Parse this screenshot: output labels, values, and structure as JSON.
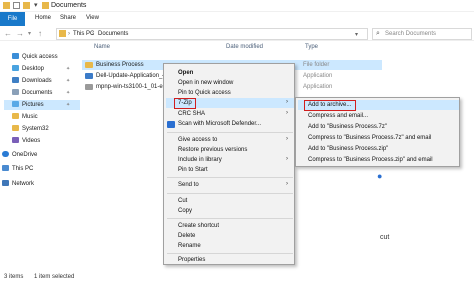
{
  "window": {
    "title": "Documents"
  },
  "ribbon": {
    "tabs": [
      "File",
      "Home",
      "Share",
      "View"
    ]
  },
  "address": {
    "path": [
      "This PC",
      "Documents"
    ],
    "search_placeholder": "Search Documents"
  },
  "nav": {
    "items": [
      {
        "label": "Quick access",
        "icon": "star-icon"
      },
      {
        "label": "Desktop",
        "icon": "desktop-icon"
      },
      {
        "label": "Downloads",
        "icon": "download-icon"
      },
      {
        "label": "Documents",
        "icon": "documents-icon"
      },
      {
        "label": "Pictures",
        "icon": "pictures-icon"
      },
      {
        "label": "Music",
        "icon": "music-icon"
      },
      {
        "label": "System32",
        "icon": "folder-icon"
      },
      {
        "label": "Videos",
        "icon": "videos-icon"
      },
      {
        "label": "OneDrive",
        "icon": "cloud-icon"
      },
      {
        "label": "This PC",
        "icon": "pc-icon"
      },
      {
        "label": "Network",
        "icon": "network-icon"
      }
    ]
  },
  "filelist": {
    "columns": {
      "name": "Name",
      "date": "Date modified",
      "type": "Type"
    },
    "rows": [
      {
        "name": "Business Process",
        "date": "",
        "type": "File folder"
      },
      {
        "name": "Dell-Update-Application_4",
        "date": "",
        "type": "Application"
      },
      {
        "name": "mpnp-win-ts3100-1_01-ea",
        "date": "",
        "type": "Application"
      }
    ]
  },
  "context_menu": {
    "items": [
      {
        "label": "Open"
      },
      {
        "label": "Open in new window"
      },
      {
        "label": "Pin to Quick access"
      },
      {
        "label": "7-Zip"
      },
      {
        "label": "CRC SHA"
      },
      {
        "label": "Scan with Microsoft Defender..."
      },
      {
        "label": "Give access to"
      },
      {
        "label": "Restore previous versions"
      },
      {
        "label": "Include in library"
      },
      {
        "label": "Pin to Start"
      },
      {
        "label": "Send to"
      },
      {
        "label": "Cut"
      },
      {
        "label": "Copy"
      },
      {
        "label": "Create shortcut"
      },
      {
        "label": "Delete"
      },
      {
        "label": "Rename"
      },
      {
        "label": "Properties"
      }
    ]
  },
  "submenu": {
    "items": [
      {
        "label": "Add to archive..."
      },
      {
        "label": "Compress and email..."
      },
      {
        "label": "Add to \"Business Process.7z\""
      },
      {
        "label": "Compress to \"Business Process.7z\" and email"
      },
      {
        "label": "Add to \"Business Process.zip\""
      },
      {
        "label": "Compress to \"Business Process.zip\" and email"
      }
    ]
  },
  "background": {
    "fragment": "cut"
  },
  "status": {
    "count": "3 items",
    "selected": "1 item selected"
  },
  "colors": {
    "selection": "#cce8ff",
    "highlight_box": "#d11e1e",
    "file_tab": "#1979ca"
  }
}
